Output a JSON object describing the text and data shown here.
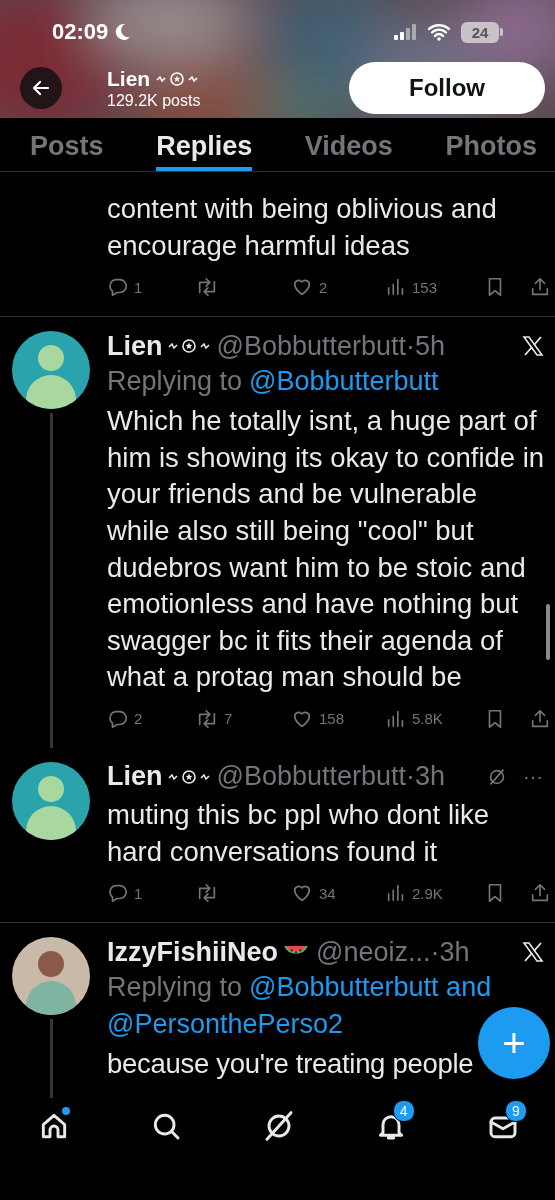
{
  "status_bar": {
    "time": "02:09",
    "battery": "24"
  },
  "header": {
    "name": "Lien",
    "name_icon": {
      "kind": "symbols"
    },
    "posts": "129.2K posts",
    "follow_button": "Follow"
  },
  "tabs": [
    {
      "label": "Posts",
      "selected": false
    },
    {
      "label": "Replies",
      "selected": true
    },
    {
      "label": "Videos",
      "selected": false
    },
    {
      "label": "Photos",
      "selected": false
    }
  ],
  "posts": [
    {
      "kind": "continuation",
      "thread_line": false,
      "text": "content with being oblivious and encourage harmful ideas",
      "stats": [
        {
          "kind": "reply",
          "count": "1"
        },
        {
          "kind": "repost"
        },
        {
          "kind": "like",
          "count": "2"
        },
        {
          "kind": "views",
          "count": "153"
        },
        {
          "kind": "bookmark"
        },
        {
          "kind": "share"
        }
      ]
    },
    {
      "kind": "post",
      "thread_line": true,
      "name": "Lien",
      "name_icon": {
        "kind": "symbols"
      },
      "handle": "@Bobbutterbutt",
      "time": "·5h",
      "corner_icon": {
        "kind": "x-logo"
      },
      "replying_label": "Replying to",
      "mentions": [
        "@Bobbutterbutt"
      ],
      "text": "Which he totally isnt, a huge part of him is showing its okay to confide in your friends and be vulnerable while also still being \"cool\" but dudebros want him to be stoic and emotionless and have nothing but swagger bc it fits their agenda of what a protag man should be",
      "stats": [
        {
          "kind": "reply",
          "count": "2"
        },
        {
          "kind": "repost",
          "count": "7"
        },
        {
          "kind": "like",
          "count": "158"
        },
        {
          "kind": "views",
          "count": "5.8K"
        },
        {
          "kind": "bookmark"
        },
        {
          "kind": "share"
        }
      ]
    },
    {
      "kind": "post",
      "thread_line": false,
      "name": "Lien",
      "name_icon": {
        "kind": "symbols"
      },
      "handle": "@Bobbutterbutt",
      "time": "·3h",
      "corner_icon": {
        "kind": "slashed-circle"
      },
      "menu": "···",
      "text": "muting this bc ppl who dont like hard conversations found it",
      "stats": [
        {
          "kind": "reply",
          "count": "1"
        },
        {
          "kind": "repost"
        },
        {
          "kind": "like",
          "count": "34"
        },
        {
          "kind": "views",
          "count": "2.9K"
        },
        {
          "kind": "bookmark"
        },
        {
          "kind": "share"
        }
      ]
    },
    {
      "kind": "post",
      "thread_line": true,
      "name": "IzzyFishiiNeo",
      "name_icon": {
        "kind": "watermelon"
      },
      "handle": "@neoiz...",
      "time": "·3h",
      "corner_icon": {
        "kind": "x-logo"
      },
      "replying_label": "Replying to",
      "mentions": [
        "@Bobbutterbutt and",
        "@PersonthePerso2"
      ],
      "text": "because you're treating people"
    }
  ],
  "nav": [
    {
      "kind": "home",
      "dot": true
    },
    {
      "kind": "search"
    },
    {
      "kind": "slashed-circle"
    },
    {
      "kind": "bell",
      "badge": "4"
    },
    {
      "kind": "mail",
      "badge": "9"
    }
  ],
  "compose_button": "+"
}
